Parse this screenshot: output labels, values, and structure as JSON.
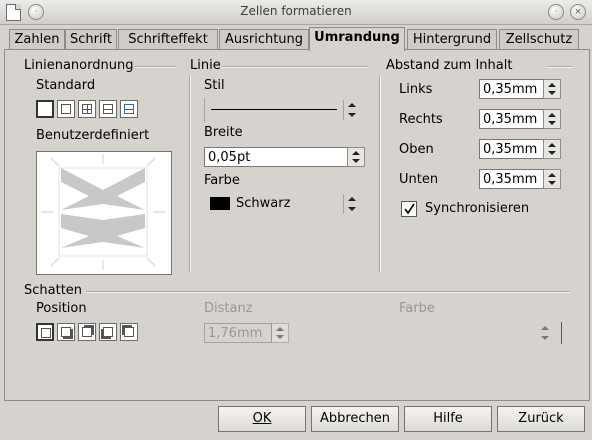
{
  "window": {
    "title": "Zellen formatieren",
    "close_glyph": "×"
  },
  "tabs": [
    "Zahlen",
    "Schrift",
    "Schrifteffekt",
    "Ausrichtung",
    "Umrandung",
    "Hintergrund",
    "Zellschutz"
  ],
  "active_tab": "Umrandung",
  "linienanordnung": {
    "heading": "Linienanordnung",
    "standard_label": "Standard",
    "benutzer_label": "Benutzerdefiniert"
  },
  "linie": {
    "heading": "Linie",
    "stil_label": "Stil",
    "breite_label": "Breite",
    "breite_value": "0,05pt",
    "farbe_label": "Farbe",
    "farbe_value": "Schwarz",
    "farbe_hex": "#000000"
  },
  "abstand": {
    "heading": "Abstand zum Inhalt",
    "fields": [
      {
        "label": "Links",
        "value": "0,35mm"
      },
      {
        "label": "Rechts",
        "value": "0,35mm"
      },
      {
        "label": "Oben",
        "value": "0,35mm"
      },
      {
        "label": "Unten",
        "value": "0,35mm"
      }
    ],
    "sync_label": "Synchronisieren",
    "sync_checked": true
  },
  "schatten": {
    "heading": "Schatten",
    "position_label": "Position",
    "distanz_label": "Distanz",
    "distanz_value": "1,76mm",
    "farbe_label": "Farbe"
  },
  "buttons": {
    "ok": "OK",
    "abbrechen": "Abbrechen",
    "hilfe": "Hilfe",
    "zurueck": "Zurück"
  }
}
